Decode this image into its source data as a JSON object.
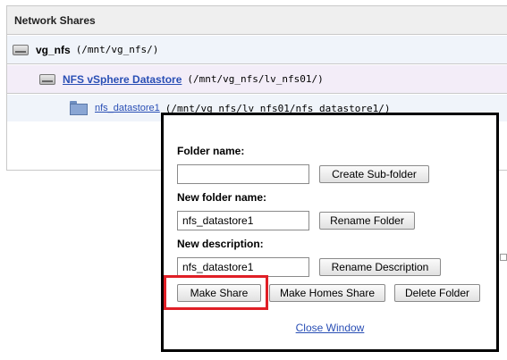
{
  "panel": {
    "title": "Network Shares",
    "rows": [
      {
        "name": "vg_nfs",
        "path": "(/mnt/vg_nfs/)"
      },
      {
        "name": "NFS vSphere Datastore",
        "path": "(/mnt/vg_nfs/lv_nfs01/)"
      },
      {
        "name": "nfs_datastore1",
        "path": "(/mnt/vg_nfs/lv_nfs01/nfs_datastore1/)"
      }
    ]
  },
  "popup": {
    "folder_name_label": "Folder name:",
    "folder_name_value": "",
    "create_subfolder_label": "Create Sub-folder",
    "new_folder_name_label": "New folder name:",
    "new_folder_name_value": "nfs_datastore1",
    "rename_folder_label": "Rename Folder",
    "new_description_label": "New description:",
    "new_description_value": "nfs_datastore1",
    "rename_description_label": "Rename Description",
    "make_share_label": "Make Share",
    "make_homes_share_label": "Make Homes Share",
    "delete_folder_label": "Delete Folder",
    "close_window_label": "Close Window"
  },
  "colors": {
    "link": "#2a4fb5",
    "highlight": "#e01f26"
  },
  "icons": {
    "volume": "disk-icon",
    "datastore": "disk-icon",
    "folder": "folder-icon"
  }
}
